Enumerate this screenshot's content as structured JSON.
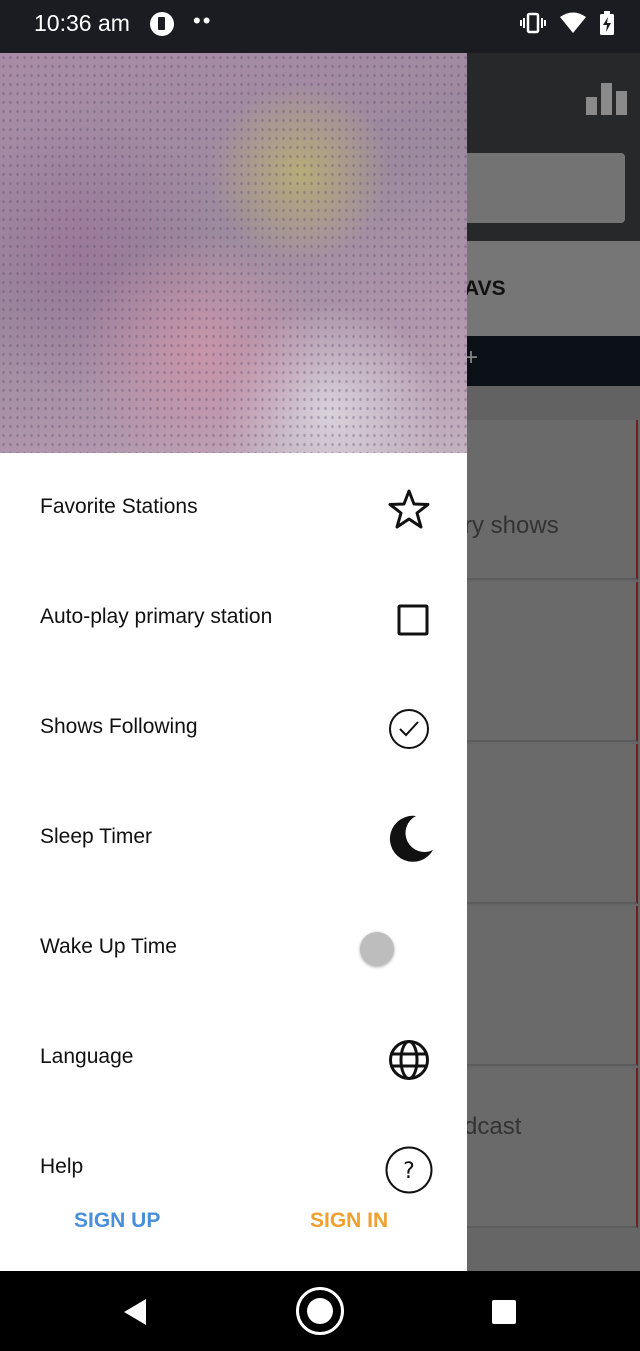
{
  "status_bar": {
    "time": "10:36 am",
    "dots": "••"
  },
  "background_app": {
    "tab_partial_label": "AVS",
    "strip_partial": "+",
    "rows": [
      {
        "text": "ry shows"
      },
      {
        "text": ""
      },
      {
        "text": ""
      },
      {
        "text": ""
      },
      {
        "text": "dcast"
      }
    ]
  },
  "drawer": {
    "menu": [
      {
        "label": "Favorite Stations",
        "icon": "star-outline-icon"
      },
      {
        "label": "Auto-play primary station",
        "icon": "checkbox-unchecked-icon"
      },
      {
        "label": "Shows Following",
        "icon": "check-circle-icon"
      },
      {
        "label": "Sleep Timer",
        "icon": "moon-icon"
      },
      {
        "label": "Wake Up Time",
        "icon": "toggle-switch"
      },
      {
        "label": "Language",
        "icon": "globe-icon"
      },
      {
        "label": "Help",
        "icon": "help-circle-icon"
      }
    ],
    "sign_up": "SIGN UP",
    "sign_in": "SIGN IN"
  },
  "colors": {
    "sign_up": "#4a8fd9",
    "sign_in": "#f0a030",
    "status_bar": "#1b1c22"
  }
}
